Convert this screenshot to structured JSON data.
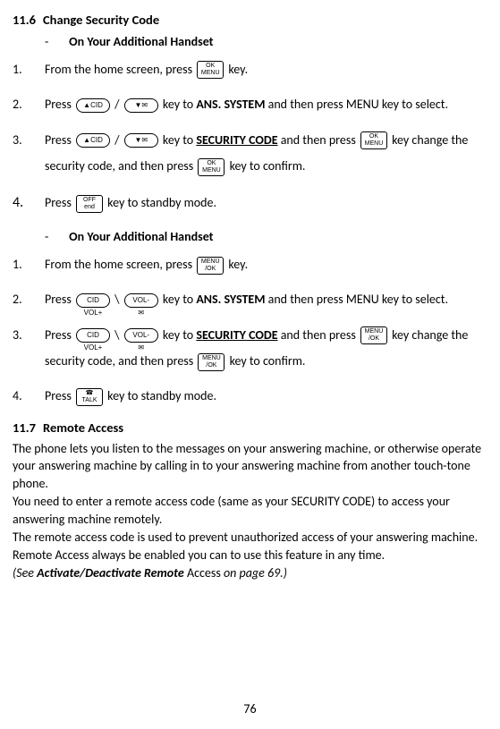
{
  "section6": {
    "number": "11.6",
    "title": "Change Security Code",
    "subA": "On Your Additional Handset",
    "stepsA": {
      "s1_a": "From the home screen, press ",
      "s1_b": " key.",
      "s2_a": "Press ",
      "s2_b": " / ",
      "s2_c": " key to ",
      "s2_d": "ANS. SYSTEM",
      "s2_e": " and then press MENU key to select.",
      "s3_a": "Press ",
      "s3_b": " / ",
      "s3_c": " key to ",
      "s3_d": "SECURITY CODE",
      "s3_e": " and then press ",
      "s3_f": " key change the security code, and then press ",
      "s3_g": " key to confirm.",
      "s4_a": "Press ",
      "s4_b": " key to standby mode."
    },
    "subB": "On Your Additional Handset",
    "stepsB": {
      "s1_a": "From the home screen, press ",
      "s1_b": " key.",
      "s2_a": "Press ",
      "s2_b": " \\ ",
      "s2_c": " key to ",
      "s2_d": "ANS. SYSTEM",
      "s2_e": " and then press MENU key to select.",
      "s3_a": "Press ",
      "s3_b": " \\ ",
      "s3_c": " key to ",
      "s3_d": "SECURITY CODE",
      "s3_e": " and then press ",
      "s3_f": " key change the security code, and then press ",
      "s3_g": " key to confirm.",
      "s4_a": "Press ",
      "s4_b": " key to standby mode."
    }
  },
  "section7": {
    "number": "11.7",
    "title": "Remote Access",
    "p1": "The phone lets you listen to the messages on your answering machine, or otherwise operate your answering machine by calling in to your answering machine from another touch-tone phone.",
    "p2": "You need to enter a remote access code (same as your SECURITY CODE) to access your answering machine remotely.",
    "p3": "The remote access code is used to prevent unauthorized access of your answering machine.",
    "p4": "Remote Access always be enabled you can to use this feature in any time.",
    "p5_a": "(See   ",
    "p5_b": "Activate/Deactivate Remote",
    "p5_c": " Access ",
    "p5_d": "on page 69.)"
  },
  "icons": {
    "ok_menu": "OK\nMENU",
    "menu_ok": "MENU\n/OK",
    "up_cid": "▲CID",
    "down_msg": "▼✉",
    "cid_volp": "CID\nVOL+",
    "vol_minus": "VOL-\n✉",
    "off_end": "OFF\nend",
    "talk": "☎\nTALK"
  },
  "steps_labels": {
    "n1": "1.",
    "n2": "2.",
    "n3": "3.",
    "n4": "4."
  },
  "dash": "-",
  "pageNumber": "76"
}
